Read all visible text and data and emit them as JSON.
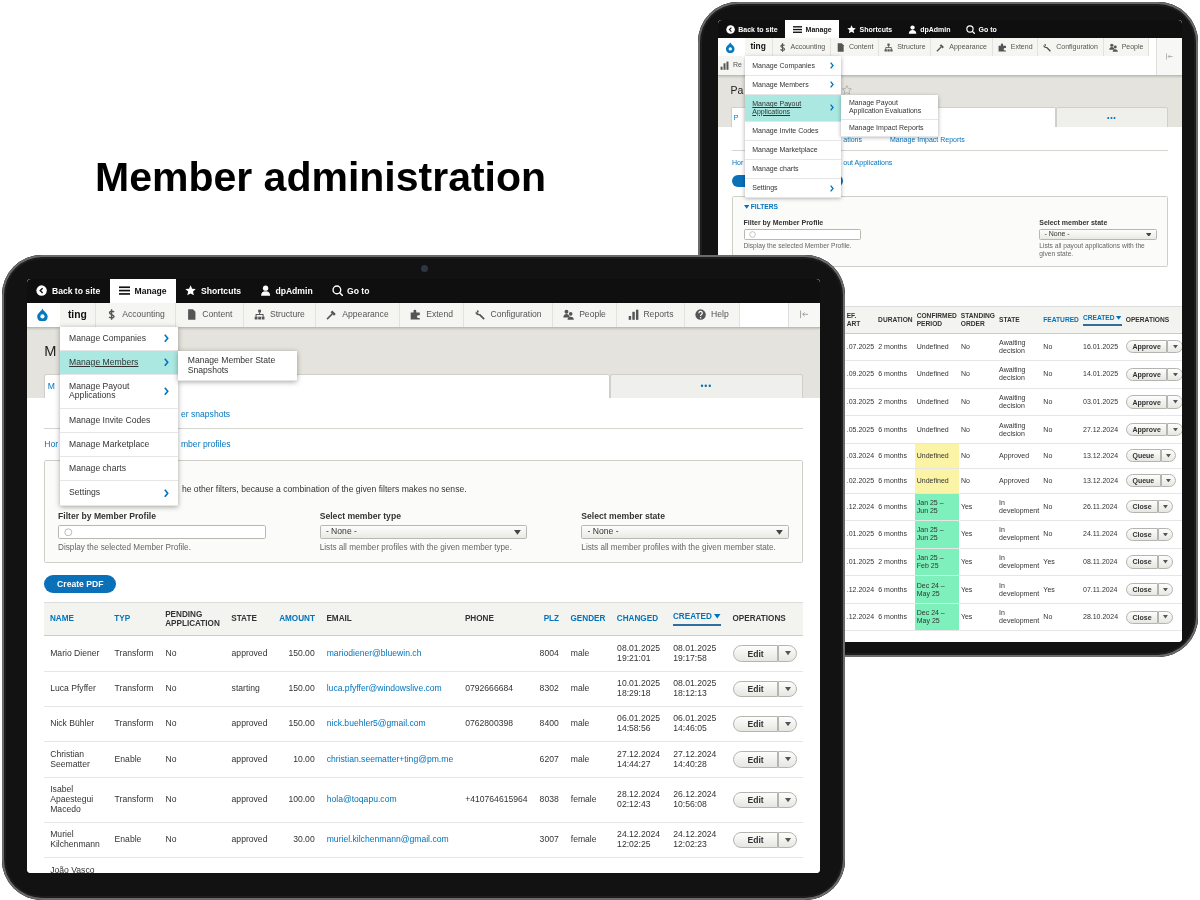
{
  "headline": "Member administration",
  "devices": [
    {
      "screen": {
        "toolbar": [
          {
            "kind": "back",
            "label": "Back to site",
            "selected": false
          },
          {
            "kind": "manage",
            "label": "Manage",
            "selected": true
          },
          {
            "kind": "shortcuts",
            "label": "Shortcuts",
            "selected": false
          },
          {
            "kind": "user",
            "label": "dpAdmin",
            "selected": false
          },
          {
            "kind": "goto",
            "label": "Go to",
            "selected": false
          }
        ],
        "nav": {
          "brand": "ting",
          "items": [
            {
              "kind": "accounting",
              "label": "Accounting"
            },
            {
              "kind": "content",
              "label": "Content"
            },
            {
              "kind": "structure",
              "label": "Structure"
            },
            {
              "kind": "appearance",
              "label": "Appearance"
            },
            {
              "kind": "extend",
              "label": "Extend"
            },
            {
              "kind": "configuration",
              "label": "Configuration"
            },
            {
              "kind": "people",
              "label": "People"
            },
            {
              "kind": "reports",
              "label": "Re"
            }
          ]
        },
        "menu": {
          "items": [
            {
              "label": "Manage Companies",
              "has_submenu": true,
              "selected": false
            },
            {
              "label": "Manage Members",
              "has_submenu": true,
              "selected": false
            },
            {
              "label": "Manage Payout Applications",
              "has_submenu": true,
              "selected": true
            },
            {
              "label": "Manage Invite Codes",
              "has_submenu": false,
              "selected": false
            },
            {
              "label": "Manage Marketplace",
              "has_submenu": false,
              "selected": false
            },
            {
              "label": "Manage charts",
              "has_submenu": false,
              "selected": false
            },
            {
              "label": "Settings",
              "has_submenu": true,
              "selected": false
            }
          ],
          "submenu": [
            "Manage Payout Application Evaluations",
            "Manage Impact Reports"
          ]
        },
        "page_title": "Pa",
        "starred": false,
        "tabs": [
          {
            "label": "P",
            "selected": true
          },
          {
            "label": "•••",
            "selected": false
          }
        ],
        "secondary_tabs": [
          {
            "label": "ations",
            "selected": false
          },
          {
            "label": "Manage Impact Reports",
            "selected": false
          }
        ],
        "breadcrumb": [
          "Hor",
          "out Applications"
        ],
        "action_button": {
          "kind": "primary"
        },
        "filters": {
          "title": "FILTERS",
          "fields": [
            {
              "kind": "autocomplete",
              "label": "Filter by Member Profile",
              "description": "Display the selected Member Profile."
            },
            {
              "kind": "select",
              "label": "Select member state",
              "value": "- None -",
              "description": "Lists all payout applications with the given state."
            }
          ]
        },
        "table": {
          "columns": [
            {
              "label": "EF. ART",
              "kind": "date",
              "sortable": false,
              "sorted": false
            },
            {
              "label": "DURATION",
              "kind": "text",
              "sortable": false,
              "sorted": false
            },
            {
              "label": "CONFIRMED PERIOD",
              "kind": "period",
              "sortable": false,
              "sorted": false
            },
            {
              "label": "STANDING ORDER",
              "kind": "flag",
              "sortable": false,
              "sorted": false
            },
            {
              "label": "STATE",
              "kind": "status",
              "sortable": false,
              "sorted": false
            },
            {
              "label": "FEATURED",
              "kind": "text",
              "sortable": true,
              "sorted": false
            },
            {
              "label": "CREATED",
              "kind": "text",
              "sortable": true,
              "sorted": true
            },
            {
              "label": "OPERATIONS",
              "kind": "operations",
              "sortable": false,
              "sorted": false
            }
          ],
          "rows": [
            [
              ".07.2025",
              "2 months",
              {
                "text": "Undefined"
              },
              "No",
              "Awaiting decision",
              "No",
              "16.01.2025",
              "Approve"
            ],
            [
              ".09.2025",
              "6 months",
              {
                "text": "Undefined"
              },
              "No",
              "Awaiting decision",
              "No",
              "14.01.2025",
              "Approve"
            ],
            [
              ".03.2025",
              "2 months",
              {
                "text": "Undefined"
              },
              "No",
              "Awaiting decision",
              "No",
              "03.01.2025",
              "Approve"
            ],
            [
              ".05.2025",
              "6 months",
              {
                "text": "Undefined"
              },
              "No",
              "Awaiting decision",
              "No",
              "27.12.2024",
              "Approve"
            ],
            [
              ".03.2024",
              "6 months",
              {
                "text": "Undefined",
                "color": "#fbf4a6"
              },
              "No",
              "Approved",
              "No",
              "13.12.2024",
              "Queue"
            ],
            [
              ".02.2025",
              "6 months",
              {
                "text": "Undefined",
                "color": "#fbf4a6"
              },
              "No",
              "Approved",
              "No",
              "13.12.2024",
              "Queue"
            ],
            [
              ".12.2024",
              "6 months",
              {
                "text": "Jan 25 – Jun 25",
                "color": "#7ef0bc"
              },
              "Yes",
              "In development",
              "No",
              "26.11.2024",
              "Close"
            ],
            [
              ".01.2025",
              "6 months",
              {
                "text": "Jan 25 – Jun 25",
                "color": "#7ef0bc"
              },
              "Yes",
              "In development",
              "No",
              "24.11.2024",
              "Close"
            ],
            [
              ".01.2025",
              "2 months",
              {
                "text": "Jan 25 – Feb 25",
                "color": "#7ef0bc"
              },
              "Yes",
              "In development",
              "Yes",
              "08.11.2024",
              "Close"
            ],
            [
              ".12.2024",
              "6 months",
              {
                "text": "Dec 24 – May 25",
                "color": "#7ef0bc"
              },
              "Yes",
              "In development",
              "Yes",
              "07.11.2024",
              "Close"
            ],
            [
              ".12.2024",
              "6 months",
              {
                "text": "Dec 24 – May 25",
                "color": "#7ef0bc"
              },
              "Yes",
              "In development",
              "No",
              "28.10.2024",
              "Close"
            ]
          ]
        }
      }
    },
    {
      "camera": true,
      "screen": {
        "toolbar": [
          {
            "kind": "back",
            "label": "Back to site",
            "selected": false
          },
          {
            "kind": "manage",
            "label": "Manage",
            "selected": true
          },
          {
            "kind": "shortcuts",
            "label": "Shortcuts",
            "selected": false
          },
          {
            "kind": "user",
            "label": "dpAdmin",
            "selected": false
          },
          {
            "kind": "goto",
            "label": "Go to",
            "selected": false
          }
        ],
        "nav": {
          "brand": "ting",
          "items": [
            {
              "kind": "accounting",
              "label": "Accounting"
            },
            {
              "kind": "content",
              "label": "Content"
            },
            {
              "kind": "structure",
              "label": "Structure"
            },
            {
              "kind": "appearance",
              "label": "Appearance"
            },
            {
              "kind": "extend",
              "label": "Extend"
            },
            {
              "kind": "configuration",
              "label": "Configuration"
            },
            {
              "kind": "people",
              "label": "People"
            },
            {
              "kind": "reports",
              "label": "Reports"
            },
            {
              "kind": "help",
              "label": "Help"
            }
          ]
        },
        "menu": {
          "items": [
            {
              "label": "Manage Companies",
              "has_submenu": true,
              "selected": false
            },
            {
              "label": "Manage Members",
              "has_submenu": true,
              "selected": true
            },
            {
              "label": "Manage Payout Applications",
              "has_submenu": true,
              "selected": false
            },
            {
              "label": "Manage Invite Codes",
              "has_submenu": false,
              "selected": false
            },
            {
              "label": "Manage Marketplace",
              "has_submenu": false,
              "selected": false
            },
            {
              "label": "Manage charts",
              "has_submenu": false,
              "selected": false
            },
            {
              "label": "Settings",
              "has_submenu": true,
              "selected": false
            }
          ],
          "submenu": [
            "Manage Member State Snapshots"
          ]
        },
        "page_title": "M",
        "tabs": [
          {
            "label": "M",
            "selected": true
          },
          {
            "label": "•••",
            "selected": false
          }
        ],
        "secondary_tabs": [
          {
            "label": "er snapshots",
            "selected": false
          }
        ],
        "breadcrumb": [
          "Hor",
          "mber profiles"
        ],
        "filters": {
          "note": "he other filters, because a combination of the given filters makes no sense.",
          "fields": [
            {
              "kind": "autocomplete",
              "label": "Filter by Member Profile",
              "description": "Display the selected Member Profile."
            },
            {
              "kind": "select",
              "label": "Select member type",
              "value": "- None -",
              "description": "Lists all member profiles with the given member type."
            },
            {
              "kind": "select",
              "label": "Select member state",
              "value": "- None -",
              "description": "Lists all member profiles with the given member state."
            }
          ]
        },
        "action_button": {
          "kind": "primary",
          "label": "Create PDF"
        },
        "table": {
          "columns": [
            {
              "label": "NAME",
              "kind": "name",
              "sortable": true,
              "sorted": false
            },
            {
              "label": "TYP",
              "kind": "text",
              "sortable": true,
              "sorted": false
            },
            {
              "label": "PENDING APPLICATION",
              "kind": "flag",
              "sortable": false,
              "sorted": false
            },
            {
              "label": "STATE",
              "kind": "text",
              "sortable": false,
              "sorted": false
            },
            {
              "label": "AMOUNT",
              "kind": "number",
              "sortable": true,
              "sorted": false
            },
            {
              "label": "EMAIL",
              "kind": "email",
              "sortable": false,
              "sorted": false
            },
            {
              "label": "PHONE",
              "kind": "text",
              "sortable": false,
              "sorted": false
            },
            {
              "label": "PLZ",
              "kind": "number",
              "sortable": true,
              "sorted": false
            },
            {
              "label": "GENDER",
              "kind": "text",
              "sortable": true,
              "sorted": false
            },
            {
              "label": "CHANGED",
              "kind": "datetime",
              "sortable": true,
              "sorted": false
            },
            {
              "label": "CREATED",
              "kind": "datetime",
              "sortable": true,
              "sorted": true
            },
            {
              "label": "OPERATIONS",
              "kind": "operations",
              "sortable": false,
              "sorted": false
            }
          ],
          "rows": [
            [
              "Mario Diener",
              "Transform",
              "No",
              "approved",
              "150.00",
              "mariodiener@bluewin.ch",
              null,
              "8004",
              "male",
              "08.01.2025 19:21:01",
              "08.01.2025 19:17:58",
              "Edit"
            ],
            [
              "Luca Pfyffer",
              "Transform",
              "No",
              "starting",
              "150.00",
              "luca.pfyffer@windowslive.com",
              "0792666684",
              "8302",
              "male",
              "10.01.2025 18:29:18",
              "08.01.2025 18:12:13",
              "Edit"
            ],
            [
              "Nick Bühler",
              "Transform",
              "No",
              "approved",
              "150.00",
              "nick.buehler5@gmail.com",
              "0762800398",
              "8400",
              "male",
              "06.01.2025 14:58:56",
              "06.01.2025 14:46:05",
              "Edit"
            ],
            [
              "Christian Seematter",
              "Enable",
              "No",
              "approved",
              "10.00",
              "christian.seematter+ting@pm.me",
              null,
              "6207",
              "male",
              "27.12.2024 14:44:27",
              "27.12.2024 14:40:28",
              "Edit"
            ],
            [
              "Isabel Apaestegui Macedo",
              "Transform",
              "No",
              "approved",
              "100.00",
              "hola@toqapu.com",
              "+410764615964",
              "8038",
              "female",
              "28.12.2024 02:12:43",
              "26.12.2024 10:56:08",
              "Edit"
            ],
            [
              "Muriel Kilchenmann",
              "Enable",
              "No",
              "approved",
              "30.00",
              "muriel.kilchenmann@gmail.com",
              null,
              "3007",
              "female",
              "24.12.2024 12:02:25",
              "24.12.2024 12:02:23",
              "Edit"
            ],
            [
              "João Vasco"
            ]
          ]
        }
      }
    }
  ]
}
